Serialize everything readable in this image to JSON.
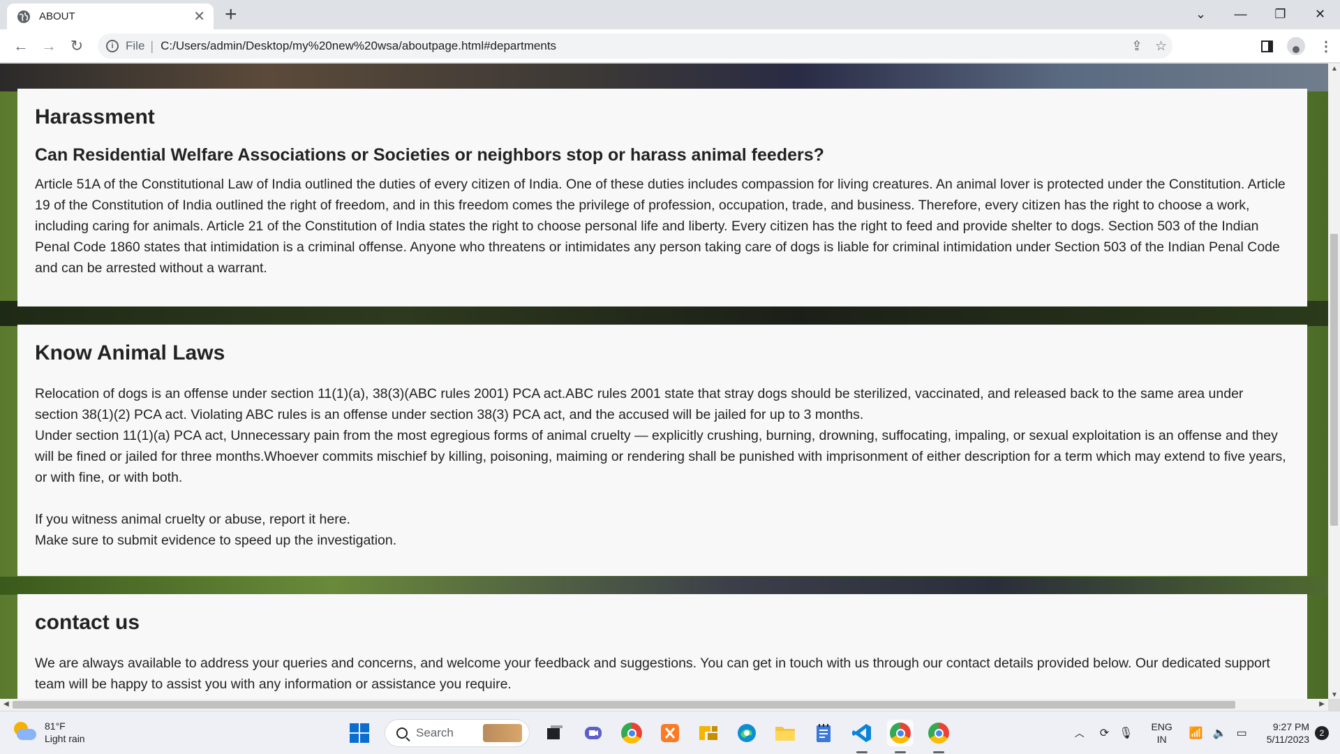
{
  "browser": {
    "tab_title": "ABOUT",
    "url_scheme_label": "File",
    "url": "C:/Users/admin/Desktop/my%20new%20wsa/aboutpage.html#departments"
  },
  "page": {
    "harassment": {
      "heading": "Harassment",
      "subheading": "Can Residential Welfare Associations or Societies or neighbors stop or harass animal feeders?",
      "body": "Article 51A of the Constitutional Law of India outlined the duties of every citizen of India. One of these duties includes compassion for living creatures. An animal lover is protected under the Constitution. Article 19 of the Constitution of India outlined the right of freedom, and in this freedom comes the privilege of profession, occupation, trade, and business. Therefore, every citizen has the right to choose a work, including caring for animals. Article 21 of the Constitution of India states the right to choose personal life and liberty. Every citizen has the right to feed and provide shelter to dogs. Section 503 of the Indian Penal Code 1860 states that intimidation is a criminal offense. Anyone who threatens or intimidates any person taking care of dogs is liable for criminal intimidation under Section 503 of the Indian Penal Code and can be arrested without a warrant."
    },
    "laws": {
      "heading": "Know Animal Laws",
      "para1": "Relocation of dogs is an offense under section 11(1)(a), 38(3)(ABC rules 2001) PCA act.ABC rules 2001 state that stray dogs should be sterilized, vaccinated, and released back to the same area under section 38(1)(2) PCA act. Violating ABC rules is an offense under section 38(3) PCA act, and the accused will be jailed for up to 3 months.",
      "para2": "Under section 11(1)(a) PCA act, Unnecessary pain from the most egregious forms of animal cruelty — explicitly crushing, burning, drowning, suffocating, impaling, or sexual exploitation is an offense and they will be fined or jailed for three months.Whoever commits mischief by killing, poisoning, maiming or rendering shall be punished with imprisonment of either description for a term which may extend to five years, or with fine, or with both.",
      "para3": "If you witness animal cruelty or abuse, report it here.",
      "para4": "Make sure to submit evidence to speed up the investigation."
    },
    "contact": {
      "heading": "contact us",
      "body": "We are always available to address your queries and concerns, and welcome your feedback and suggestions. You can get in touch with us through our contact details provided below. Our dedicated support team will be happy to assist you with any information or assistance you require."
    }
  },
  "taskbar": {
    "weather_temp": "81°F",
    "weather_desc": "Light rain",
    "search_placeholder": "Search",
    "lang_line1": "ENG",
    "lang_line2": "IN",
    "time": "9:27 PM",
    "date": "5/11/2023",
    "notification_count": "2"
  }
}
